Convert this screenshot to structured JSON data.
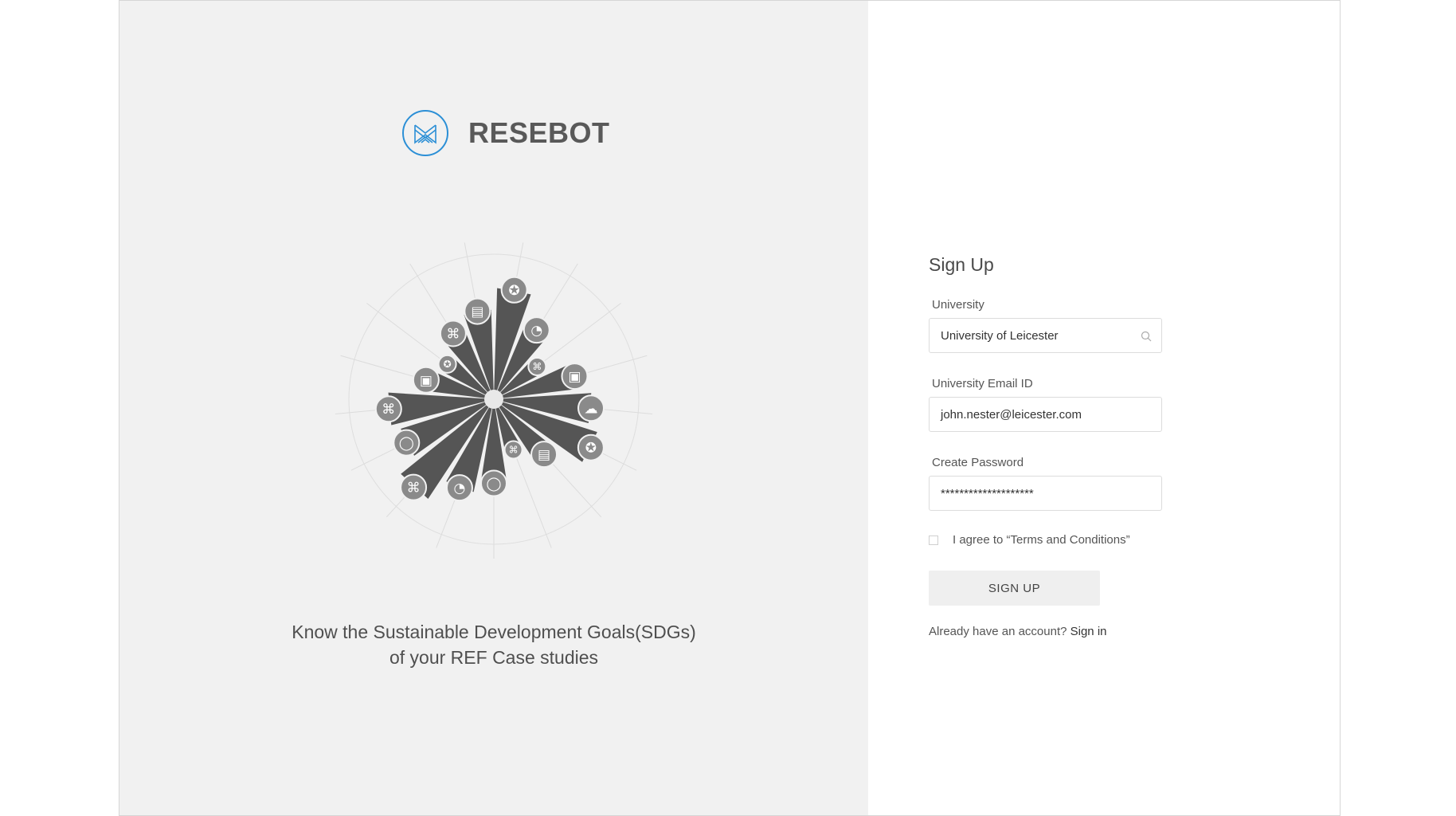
{
  "brand": {
    "name": "RESEBOT",
    "accent": "#2b8fd6"
  },
  "tagline": {
    "line1": "Know the Sustainable Development Goals(SDGs)",
    "line2": "of your REF Case studies"
  },
  "form": {
    "title": "Sign Up",
    "university_label": "University",
    "university_value": "University of Leicester",
    "email_label": "University Email ID",
    "email_value": "john.nester@leicester.com",
    "password_label": "Create Password",
    "password_value": "********************",
    "agree_text": "I agree to “Terms and Conditions”",
    "submit_label": "SIGN UP",
    "already_text": "Already have an account?",
    "signin_link": "Sign in"
  },
  "chart_data": {
    "type": "radial-bar",
    "series": [
      {
        "icon": "award-icon",
        "value": 0.82
      },
      {
        "icon": "pie-chart-icon",
        "value": 0.6
      },
      {
        "icon": "command-icon",
        "value": 0.4
      },
      {
        "icon": "gift-icon",
        "value": 0.62
      },
      {
        "icon": "cloud-icon",
        "value": 0.72
      },
      {
        "icon": "award-icon",
        "value": 0.8
      },
      {
        "icon": "book-icon",
        "value": 0.55
      },
      {
        "icon": "command-icon",
        "value": 0.4
      },
      {
        "icon": "chat-icon",
        "value": 0.62
      },
      {
        "icon": "pie-chart-icon",
        "value": 0.7
      },
      {
        "icon": "command-icon",
        "value": 0.88
      },
      {
        "icon": "chat-icon",
        "value": 0.72
      },
      {
        "icon": "command-icon",
        "value": 0.78
      },
      {
        "icon": "gift-icon",
        "value": 0.52
      },
      {
        "icon": "award-icon",
        "value": 0.43
      },
      {
        "icon": "command-icon",
        "value": 0.57
      },
      {
        "icon": "book-icon",
        "value": 0.66
      }
    ]
  }
}
